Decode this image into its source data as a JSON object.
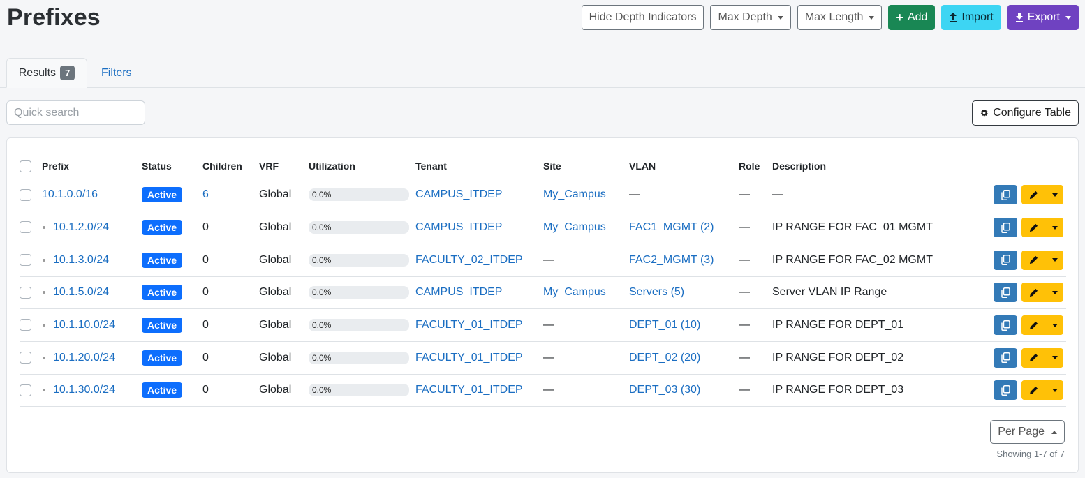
{
  "page": {
    "title": "Prefixes"
  },
  "toolbar": {
    "hide_depth": "Hide Depth Indicators",
    "max_depth": "Max Depth",
    "max_length": "Max Length",
    "add": "Add",
    "import": "Import",
    "export": "Export"
  },
  "tabs": {
    "results": "Results",
    "results_count": "7",
    "filters": "Filters"
  },
  "search": {
    "placeholder": "Quick search"
  },
  "configure_table": "Configure Table",
  "table": {
    "headers": [
      "Prefix",
      "Status",
      "Children",
      "VRF",
      "Utilization",
      "Tenant",
      "Site",
      "VLAN",
      "Role",
      "Description"
    ],
    "rows": [
      {
        "prefix": "10.1.0.0/16",
        "depth": 0,
        "status": "Active",
        "children": "6",
        "children_link": true,
        "vrf": "Global",
        "utilization": "0.0%",
        "tenant": "CAMPUS_ITDEP",
        "site": "My_Campus",
        "vlan": "—",
        "role": "—",
        "description": "—"
      },
      {
        "prefix": "10.1.2.0/24",
        "depth": 1,
        "status": "Active",
        "children": "0",
        "children_link": false,
        "vrf": "Global",
        "utilization": "0.0%",
        "tenant": "CAMPUS_ITDEP",
        "site": "My_Campus",
        "vlan": "FAC1_MGMT (2)",
        "role": "—",
        "description": "IP RANGE FOR FAC_01 MGMT"
      },
      {
        "prefix": "10.1.3.0/24",
        "depth": 1,
        "status": "Active",
        "children": "0",
        "children_link": false,
        "vrf": "Global",
        "utilization": "0.0%",
        "tenant": "FACULTY_02_ITDEP",
        "site": "—",
        "vlan": "FAC2_MGMT (3)",
        "role": "—",
        "description": "IP RANGE FOR FAC_02 MGMT"
      },
      {
        "prefix": "10.1.5.0/24",
        "depth": 1,
        "status": "Active",
        "children": "0",
        "children_link": false,
        "vrf": "Global",
        "utilization": "0.0%",
        "tenant": "CAMPUS_ITDEP",
        "site": "My_Campus",
        "vlan": "Servers (5)",
        "role": "—",
        "description": "Server VLAN IP Range"
      },
      {
        "prefix": "10.1.10.0/24",
        "depth": 1,
        "status": "Active",
        "children": "0",
        "children_link": false,
        "vrf": "Global",
        "utilization": "0.0%",
        "tenant": "FACULTY_01_ITDEP",
        "site": "—",
        "vlan": "DEPT_01 (10)",
        "role": "—",
        "description": "IP RANGE FOR DEPT_01"
      },
      {
        "prefix": "10.1.20.0/24",
        "depth": 1,
        "status": "Active",
        "children": "0",
        "children_link": false,
        "vrf": "Global",
        "utilization": "0.0%",
        "tenant": "FACULTY_01_ITDEP",
        "site": "—",
        "vlan": "DEPT_02 (20)",
        "role": "—",
        "description": "IP RANGE FOR DEPT_02"
      },
      {
        "prefix": "10.1.30.0/24",
        "depth": 1,
        "status": "Active",
        "children": "0",
        "children_link": false,
        "vrf": "Global",
        "utilization": "0.0%",
        "tenant": "FACULTY_01_ITDEP",
        "site": "—",
        "vlan": "DEPT_03 (30)",
        "role": "—",
        "description": "IP RANGE FOR DEPT_03"
      }
    ]
  },
  "pagination": {
    "per_page": "Per Page",
    "showing": "Showing 1-7 of 7"
  },
  "colors": {
    "link": "#1b6ec2",
    "status_active": "#0d6efd",
    "add": "#198754",
    "import": "#3dd5f3",
    "export": "#6f42c1",
    "edit": "#ffc107",
    "copy": "#337ab7"
  }
}
